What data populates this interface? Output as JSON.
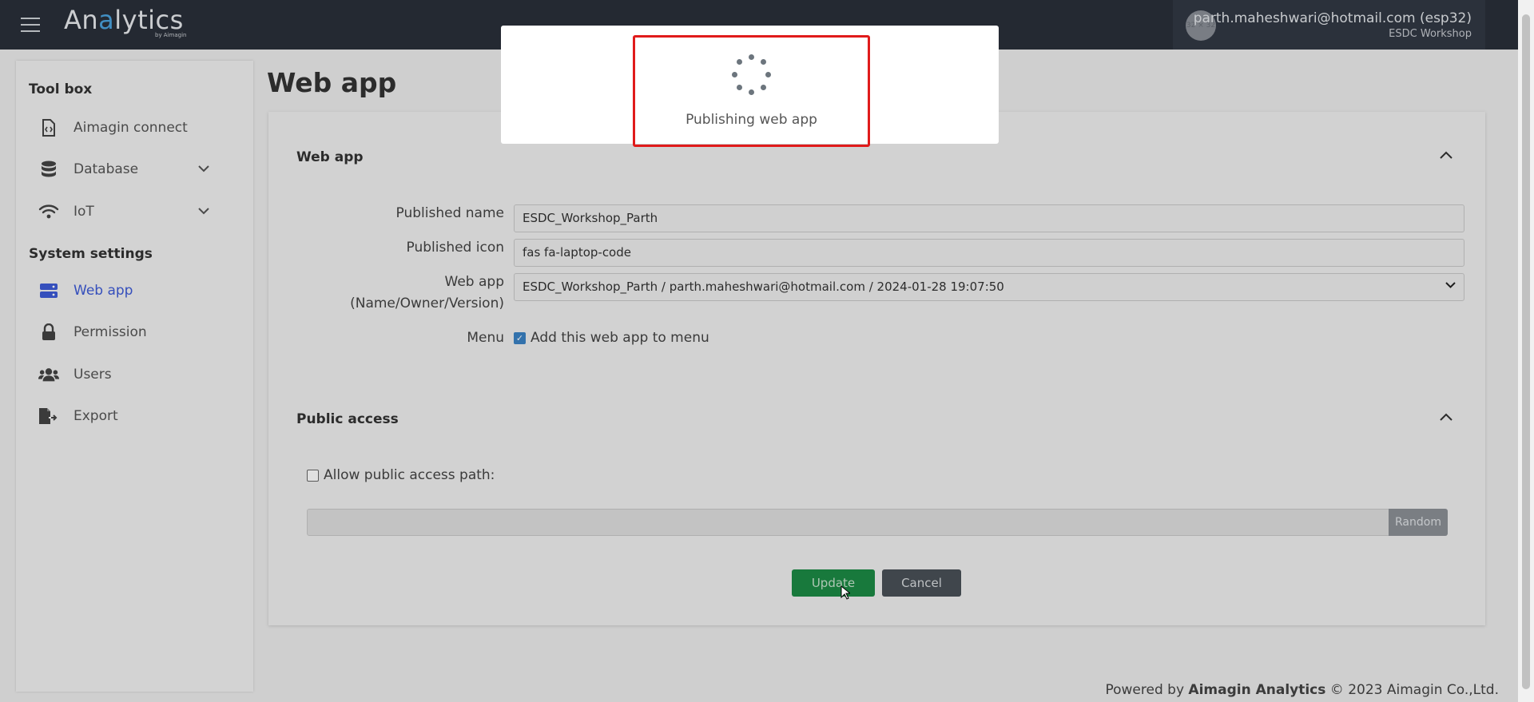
{
  "navbar": {
    "brand_left": "An",
    "brand_accent": "a",
    "brand_right": "lytics",
    "brand_sub": "by Aimagin",
    "avatar_text": "32 × 32",
    "user_email": "parth.maheshwari@hotmail.com (esp32)",
    "user_org": "ESDC Workshop"
  },
  "sidebar": {
    "toolbox_label": "Tool box",
    "system_label": "System settings",
    "items": [
      {
        "label": "Aimagin connect",
        "icon": "file-code-icon"
      },
      {
        "label": "Database",
        "icon": "database-icon",
        "expandable": true
      },
      {
        "label": "IoT",
        "icon": "wifi-icon",
        "expandable": true
      },
      {
        "label": "Web app",
        "icon": "server-icon",
        "active": true
      },
      {
        "label": "Permission",
        "icon": "lock-icon"
      },
      {
        "label": "Users",
        "icon": "users-icon"
      },
      {
        "label": "Export",
        "icon": "file-export-icon"
      }
    ]
  },
  "main": {
    "title": "Web app",
    "webapp_panel": {
      "title": "Web app",
      "published_name_label": "Published name",
      "published_name_value": "ESDC_Workshop_Parth",
      "published_icon_label": "Published icon",
      "published_icon_value": "fas fa-laptop-code",
      "webapp_label_line1": "Web app",
      "webapp_label_line2": "(Name/Owner/Version)",
      "webapp_select_value": "ESDC_Workshop_Parth / parth.maheshwari@hotmail.com / 2024-01-28 19:07:50",
      "menu_label": "Menu",
      "menu_checkbox_label": "Add this web app to menu",
      "menu_checked": true
    },
    "public_panel": {
      "title": "Public access",
      "allow_label": "Allow public access path:",
      "allow_checked": false,
      "path_value": "",
      "random_label": "Random"
    },
    "update_label": "Update",
    "cancel_label": "Cancel"
  },
  "footer": {
    "prefix": "Powered by ",
    "brand": "Aimagin Analytics",
    "suffix": " © 2023 Aimagin Co.,Ltd."
  },
  "modal": {
    "message": "Publishing web app"
  },
  "colors": {
    "navbar": "#2a2f39",
    "active_link": "#3d5ad6",
    "update_button": "#1c8a45",
    "cancel_button": "#495057",
    "highlight": "#e01b1b"
  }
}
